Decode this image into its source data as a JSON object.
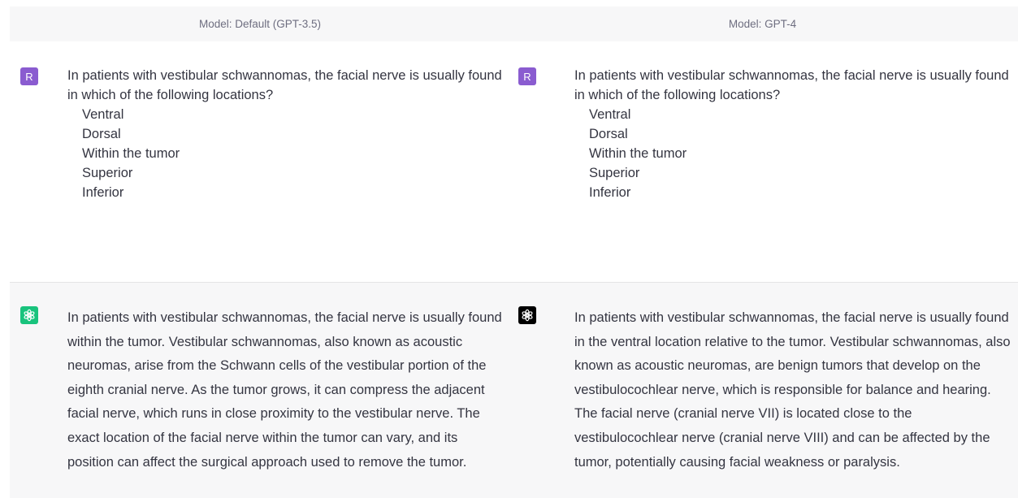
{
  "columns": [
    {
      "model_label": "Model: Default (GPT-3.5)",
      "user_avatar": "R",
      "question": "In patients with vestibular schwannomas, the facial nerve is usually found in which of the following locations?",
      "options": [
        "Ventral",
        "Dorsal",
        "Within the tumor",
        "Superior",
        "Inferior"
      ],
      "assistant_icon": "openai-logo-icon",
      "assistant_icon_bg": "#19c37d",
      "answer": "In patients with vestibular schwannomas, the facial nerve is usually found within the tumor. Vestibular schwannomas, also known as acoustic neuromas, arise from the Schwann cells of the vestibular portion of the eighth cranial nerve. As the tumor grows, it can compress the adjacent facial nerve, which runs in close proximity to the vestibular nerve. The exact location of the facial nerve within the tumor can vary, and its position can affect the surgical approach used to remove the tumor."
    },
    {
      "model_label": "Model: GPT-4",
      "user_avatar": "R",
      "question": "In patients with vestibular schwannomas, the facial nerve is usually found in which of the following locations?",
      "options": [
        "Ventral",
        "Dorsal",
        "Within the tumor",
        "Superior",
        "Inferior"
      ],
      "assistant_icon": "openai-logo-icon",
      "assistant_icon_bg": "#000000",
      "answer": "In patients with vestibular schwannomas, the facial nerve is usually found in the ventral location relative to the tumor. Vestibular schwannomas, also known as acoustic neuromas, are benign tumors that develop on the vestibulocochlear nerve, which is responsible for balance and hearing. The facial nerve (cranial nerve VII) is located close to the vestibulocochlear nerve (cranial nerve VIII) and can be affected by the tumor, potentially causing facial weakness or paralysis."
    }
  ],
  "colors": {
    "user_avatar_bg": "#8a5cd0",
    "assistant_row_bg": "#f7f7f8",
    "model_bar_bg": "#f7f7f8",
    "text": "#343541"
  }
}
